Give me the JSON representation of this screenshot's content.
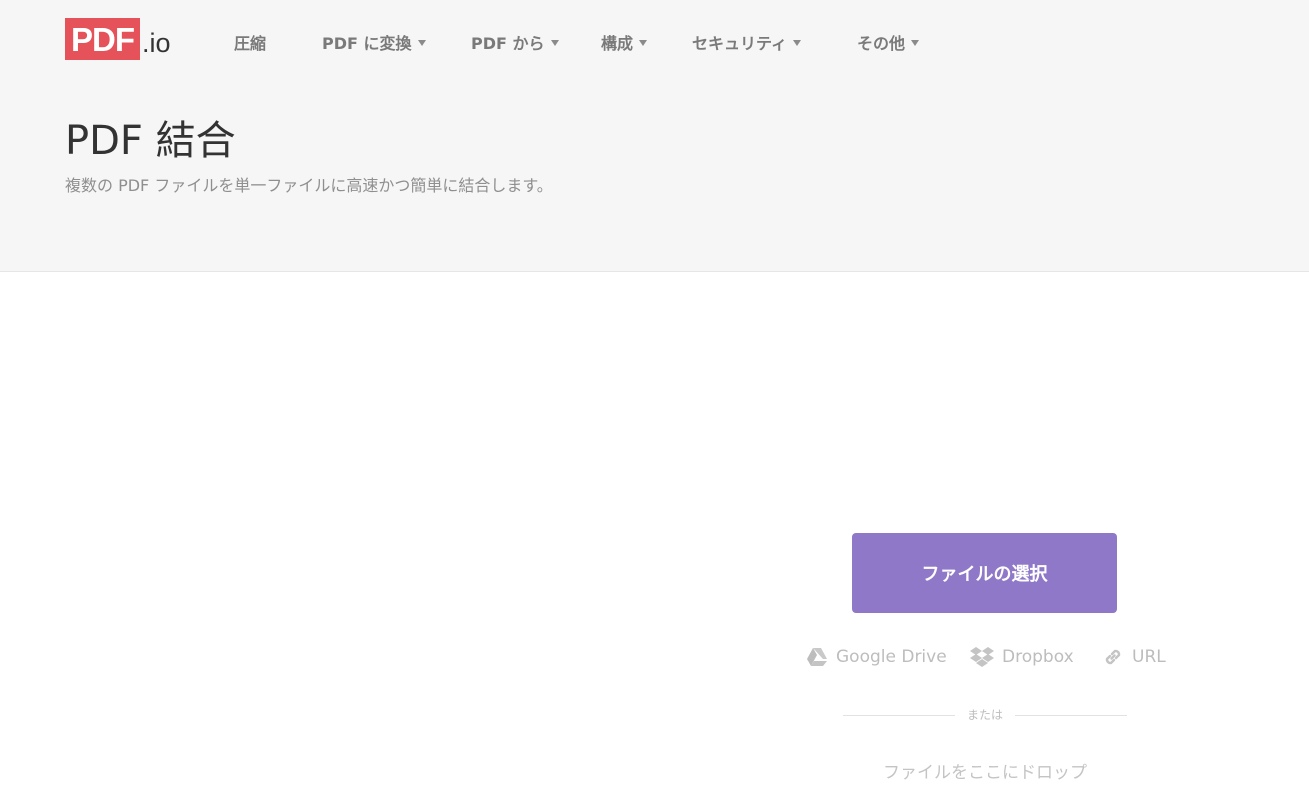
{
  "logo": {
    "brand": "PDF",
    "ext": ".io"
  },
  "nav": [
    {
      "label": "圧縮",
      "dropdown": false
    },
    {
      "label": "PDF に変換",
      "dropdown": true
    },
    {
      "label": "PDF から",
      "dropdown": true
    },
    {
      "label": "構成",
      "dropdown": true
    },
    {
      "label": "セキュリティ",
      "dropdown": true
    },
    {
      "label": "その他",
      "dropdown": true
    }
  ],
  "header": {
    "title": "PDF 結合",
    "subtitle": "複数の PDF ファイルを単一ファイルに高速かつ簡単に結合します。"
  },
  "upload": {
    "select_label": "ファイルの選択",
    "sources": [
      {
        "label": "Google Drive",
        "icon": "google-drive-icon"
      },
      {
        "label": "Dropbox",
        "icon": "dropbox-icon"
      },
      {
        "label": "URL",
        "icon": "link-icon"
      }
    ],
    "or_label": "または",
    "drop_label": "ファイルをここにドロップ"
  },
  "colors": {
    "brand": "#e5525a",
    "accent": "#8f78c8"
  }
}
